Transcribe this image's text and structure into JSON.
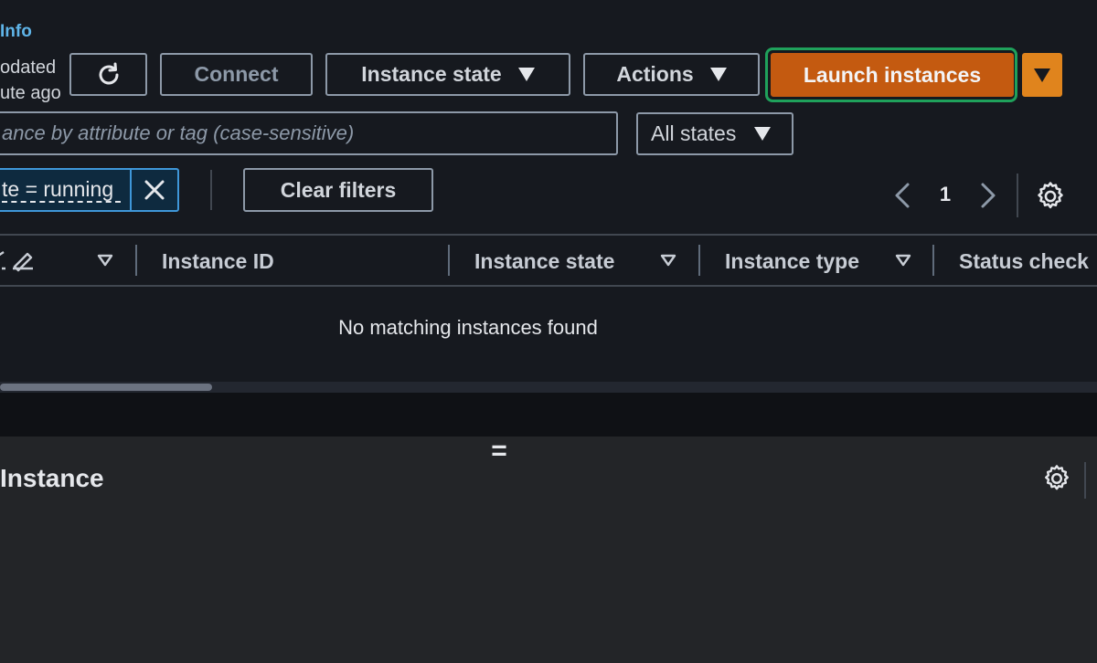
{
  "header": {
    "info_link": "Info",
    "last_updated_line1": "odated",
    "last_updated_line2": "ute ago"
  },
  "toolbar": {
    "refresh_icon": "refresh-icon",
    "connect_label": "Connect",
    "instance_state_label": "Instance state",
    "actions_label": "Actions",
    "launch_label": "Launch instances",
    "launch_color": "#c45a10",
    "highlight_color": "#1fa15b"
  },
  "search": {
    "placeholder": "ance by attribute or tag (case-sensitive)"
  },
  "state_filter": {
    "selected": "All states"
  },
  "filters": {
    "chip_label": "te = running",
    "clear_label": "Clear filters"
  },
  "pagination": {
    "current_page": "1"
  },
  "table": {
    "columns": [
      "Instance ID",
      "Instance state",
      "Instance type",
      "Status check"
    ],
    "empty_message": "No matching instances found"
  },
  "details_panel": {
    "resize_handle": "=",
    "title": "Instance"
  }
}
